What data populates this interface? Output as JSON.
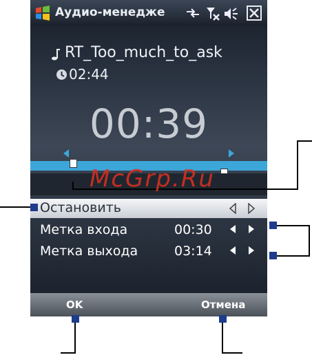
{
  "title_bar": {
    "app_title": "Аудио-менедже",
    "icons": [
      "windows-start-icon",
      "connectivity-icon",
      "signal-off-icon",
      "volume-icon",
      "close-icon"
    ]
  },
  "player": {
    "track_name": "RT_Too_much_to_ask",
    "duration": "02:44",
    "position": "00:39"
  },
  "menu": {
    "selected_item": "Остановить",
    "mark_in_label": "Метка входа",
    "mark_in_value": "00:30",
    "mark_out_label": "Метка выхода",
    "mark_out_value": "03:14"
  },
  "softkeys": {
    "left": "OK",
    "right": "Отмена"
  },
  "watermark": "McGrp.Ru",
  "colors": {
    "progress_bar": "#3da6d8",
    "callout_dot": "#1f3c8c",
    "watermark": "#d72f1f"
  }
}
